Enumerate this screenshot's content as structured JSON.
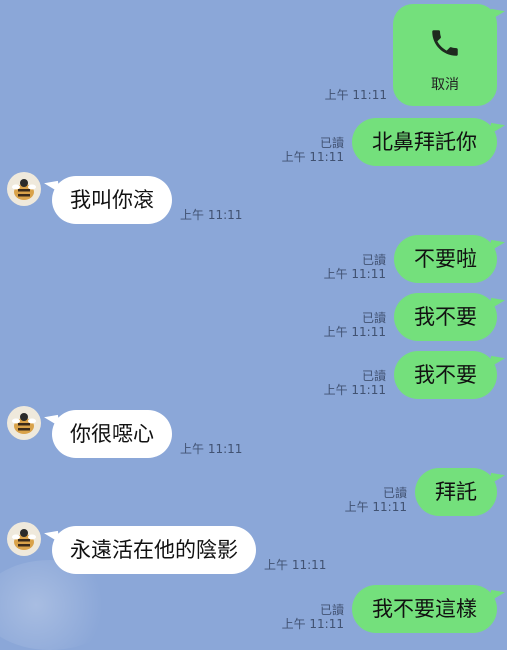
{
  "call": {
    "label": "取消",
    "time": "上午 11:11",
    "icon": "phone-icon"
  },
  "colors": {
    "background": "#8ba7d8",
    "outgoing": "#74e07c",
    "incoming": "#ffffff"
  },
  "messages": [
    {
      "dir": "out",
      "text": "北鼻拜託你",
      "read": "已讀",
      "time": "上午 11:11"
    },
    {
      "dir": "in",
      "text": "我叫你滾",
      "time": "上午 11:11"
    },
    {
      "dir": "out",
      "text": "不要啦",
      "read": "已讀",
      "time": "上午 11:11"
    },
    {
      "dir": "out",
      "text": "我不要",
      "read": "已讀",
      "time": "上午 11:11"
    },
    {
      "dir": "out",
      "text": "我不要",
      "read": "已讀",
      "time": "上午 11:11"
    },
    {
      "dir": "in",
      "text": "你很噁心",
      "time": "上午 11:11"
    },
    {
      "dir": "out",
      "text": "拜託",
      "read": "已讀",
      "time": "上午 11:11"
    },
    {
      "dir": "in",
      "text": "永遠活在他的陰影",
      "time": "上午 11:11"
    },
    {
      "dir": "out",
      "text": "我不要這樣",
      "read": "已讀",
      "time": "上午 11:11"
    }
  ]
}
